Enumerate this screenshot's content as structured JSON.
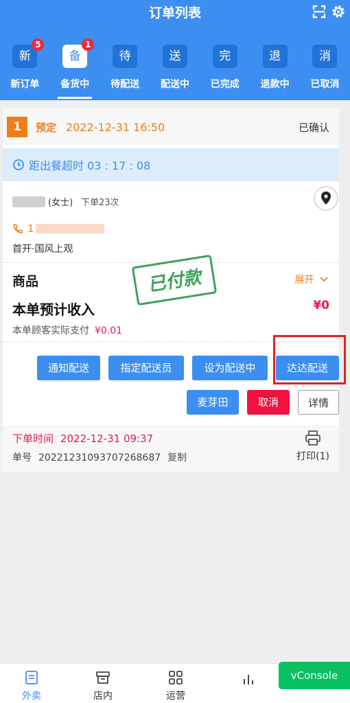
{
  "header": {
    "title": "订单列表"
  },
  "tabs": [
    {
      "box": "新",
      "label": "新订单",
      "badge": "5"
    },
    {
      "box": "备",
      "label": "备货中",
      "badge": "1",
      "active": true
    },
    {
      "box": "待",
      "label": "待配送"
    },
    {
      "box": "送",
      "label": "配送中"
    },
    {
      "box": "完",
      "label": "已完成"
    },
    {
      "box": "退",
      "label": "退款中"
    },
    {
      "box": "消",
      "label": "已取消"
    }
  ],
  "order": {
    "index": "1",
    "pre_label": "预定",
    "pre_time": "2022-12-31 16:50",
    "status": "已确认",
    "timer_text": "距出餐超时 03 : 17 : 08",
    "gender": "(女士)",
    "order_times": "下单23次",
    "phone_prefix": "1",
    "address": "首开·国风上观",
    "goods_label": "商品",
    "expand_label": "展开",
    "income_label": "本单预计收入",
    "income_value": "¥0",
    "paid_label": "本单顾客实际支付",
    "paid_value": "¥0.01",
    "stamp_text": "已付款",
    "buttons": {
      "notify": "通知配送",
      "assign": "指定配送员",
      "set_delivering": "设为配送中",
      "dada": "达达配送",
      "maiyatian": "麦芽田",
      "cancel": "取消",
      "detail": "详情"
    },
    "order_time_label": "下单时间",
    "order_time": "2022-12-31 09:37",
    "order_no_label": "单号",
    "order_no": "20221231093707268687",
    "copy_label": "复制",
    "print_label": "打印(1)"
  },
  "bottom_nav": [
    {
      "label": "外卖",
      "active": true
    },
    {
      "label": "店内"
    },
    {
      "label": "运营"
    }
  ],
  "vconsole_label": "vConsole",
  "colors": {
    "brand": "#3c8ef0",
    "orange": "#f07d1a",
    "red": "#e8184b",
    "green": "#07c160"
  }
}
